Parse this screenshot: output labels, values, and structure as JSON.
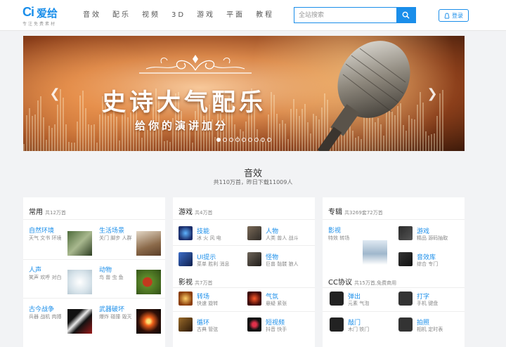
{
  "logo": {
    "mark": "Ci",
    "name": "爱给",
    "slogan": "专注免费素材"
  },
  "nav": [
    "音效",
    "配乐",
    "视频",
    "3D",
    "游戏",
    "平面",
    "教程"
  ],
  "search": {
    "placeholder": "全站搜索"
  },
  "login": {
    "label": "登录"
  },
  "banner": {
    "title": "史诗大气配乐",
    "subtitle": "给你的演讲加分",
    "slide_count": 9,
    "active_slide": 1
  },
  "section": {
    "title": "音效",
    "subtitle": "共110万首，昨日下载11009人"
  },
  "panels": [
    {
      "title": "常用",
      "count": "共12万首",
      "items": [
        {
          "name": "自然环境",
          "tags": "天气 文书 环境"
        },
        {
          "name": "生活场景",
          "tags": "关门 脚步 人群"
        },
        {
          "name": "人声",
          "tags": "笑声 欢呼 对白"
        },
        {
          "name": "动物",
          "tags": "鸟 兽 虫 鱼"
        },
        {
          "name": "古今战争",
          "tags": "兵器 战机 肉搏"
        },
        {
          "name": "武器破坏",
          "tags": "爆炸 碰撞 毁灭"
        }
      ]
    },
    {
      "title": "游戏",
      "count": "共4万首",
      "items": [
        {
          "name": "技能",
          "tags": "冰 火 风 电"
        },
        {
          "name": "人物",
          "tags": "人类 兽人 战斗"
        },
        {
          "name": "UI提示",
          "tags": "菜单 胜利 消息"
        },
        {
          "name": "怪物",
          "tags": "巨兽 骷髅 狼人"
        }
      ],
      "sub_title": "影视",
      "sub_count": "共7万首",
      "sub_items": [
        {
          "name": "转场",
          "tags": "快速 旋转"
        },
        {
          "name": "气氛",
          "tags": "悬疑 紧张"
        },
        {
          "name": "循环",
          "tags": "古典 管弦"
        },
        {
          "name": "短视频",
          "tags": "抖音 快手"
        }
      ]
    },
    {
      "title": "专辑",
      "count": "共3269套72万首",
      "items": [
        {
          "name": "影视",
          "tags": "特效 转场"
        },
        {
          "name": "游戏",
          "tags": "精品 源码抽取"
        },
        {
          "name": "音效库",
          "tags": "综合 专门"
        }
      ],
      "sub_title": "CC协议",
      "sub_count": "共15万首,免费商用",
      "sub_items": [
        {
          "name": "弹出",
          "tags": "元素 气泡"
        },
        {
          "name": "打字",
          "tags": "手机 键盘"
        },
        {
          "name": "敲门",
          "tags": "木门 铁门"
        },
        {
          "name": "拍照",
          "tags": "相机 定时表"
        }
      ]
    }
  ],
  "colors": {
    "accent": "#1a8eea",
    "background": "#f2f3f5"
  }
}
